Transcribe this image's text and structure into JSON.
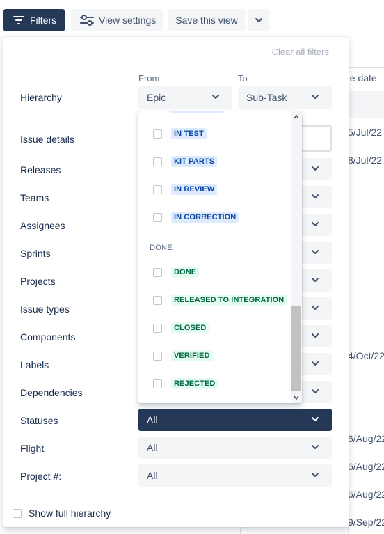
{
  "toolbar": {
    "filters_label": "Filters",
    "view_settings_label": "View settings",
    "save_view_label": "Save this view"
  },
  "background": {
    "column_header": "ue date",
    "dates": [
      "5/Jul/22",
      "8/Jul/22",
      "4/Oct/22",
      "6/Aug/22",
      "6/Aug/22",
      "6/Aug/22",
      "9/Sep/22"
    ]
  },
  "panel": {
    "clear_all": "Clear all filters",
    "from_label": "From",
    "to_label": "To",
    "rows": {
      "hierarchy": "Hierarchy",
      "issue_details": "Issue details",
      "releases": "Releases",
      "teams": "Teams",
      "assignees": "Assignees",
      "sprints": "Sprints",
      "projects": "Projects",
      "issue_types": "Issue types",
      "components": "Components",
      "labels": "Labels",
      "dependencies": "Dependencies",
      "statuses": "Statuses",
      "flight": "Flight",
      "project_num": "Project #:"
    },
    "hierarchy_from": "Epic",
    "hierarchy_to": "Sub-Task",
    "statuses_value": "All",
    "flight_value": "All",
    "project_num_value": "All",
    "show_full_hierarchy": "Show full hierarchy"
  },
  "status_menu": {
    "in_progress_items": [
      "IN TEST",
      "KIT PARTS",
      "IN REVIEW",
      "IN CORRECTION"
    ],
    "done_group": "DONE",
    "done_items": [
      "DONE",
      "RELEASED TO INTEGRATION",
      "CLOSED",
      "VERIFIED",
      "REJECTED"
    ]
  },
  "colors": {
    "primary_dark": "#253858",
    "lozenge_blue_bg": "#deebff",
    "lozenge_blue_text": "#0747a6",
    "lozenge_green_bg": "#e3fcef",
    "lozenge_green_text": "#006644"
  }
}
